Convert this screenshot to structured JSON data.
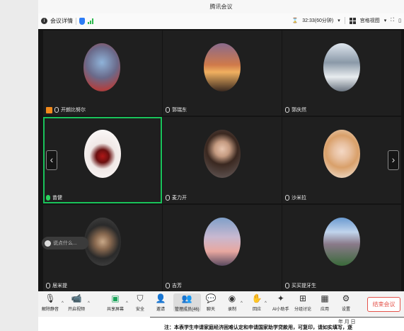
{
  "window": {
    "title": "腾讯会议"
  },
  "infobar": {
    "meeting_details": "会议详情",
    "timer": "32:33(60分钟)",
    "view_mode": "宫格视图"
  },
  "participants": [
    {
      "name": "开朗比努尔",
      "is_host": true
    },
    {
      "name": "郭瑞东"
    },
    {
      "name": "郭庆然"
    },
    {
      "name": "苗健",
      "speaking": true
    },
    {
      "name": "麦力开"
    },
    {
      "name": "沙米拉"
    },
    {
      "name": "居米提"
    },
    {
      "name": "吉芳"
    },
    {
      "name": "买买提牙生"
    }
  ],
  "chat": {
    "placeholder": "说点什么..."
  },
  "toolbar": {
    "mute": "解除静音",
    "video": "开启视频",
    "share": "共享屏幕",
    "security": "安全",
    "invite": "邀请",
    "members": "管理成员(46)",
    "chat": "聊天",
    "record": "录制",
    "reactions": "回应",
    "ai_assistant": "AI小助手",
    "breakout": "分组讨论",
    "apps": "应用",
    "settings": "设置",
    "end_meeting": "结束会议"
  },
  "document_bg": {
    "note": "注：本表学生申请家庭经济困难认定和申请国家助学贷款用，可复印，请如实填写，逐",
    "date": "年    月    日"
  }
}
